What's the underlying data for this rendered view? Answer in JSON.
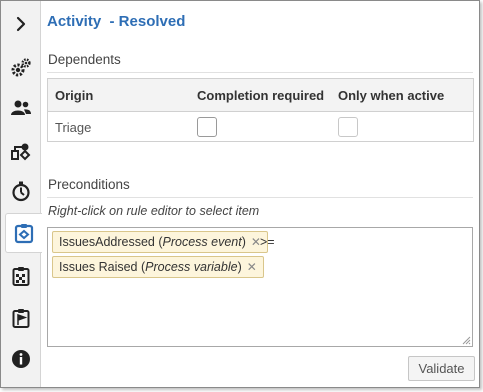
{
  "colors": {
    "accent": "#2e6eb5",
    "token_bg": "#fdf5dc",
    "token_border": "#d9c68b"
  },
  "sidebar": {
    "items": [
      {
        "icon": "chevron-right-icon"
      },
      {
        "icon": "gears-icon"
      },
      {
        "icon": "users-icon"
      },
      {
        "icon": "flowchart-icon"
      },
      {
        "icon": "stopwatch-icon"
      },
      {
        "icon": "activity-clipboard-icon",
        "active": true
      },
      {
        "icon": "checkered-clipboard-icon"
      },
      {
        "icon": "flag-clipboard-icon"
      },
      {
        "icon": "info-icon"
      }
    ]
  },
  "header": {
    "title": "Activity  - Resolved"
  },
  "dependents": {
    "label": "Dependents",
    "columns": [
      "Origin",
      "Completion required",
      "Only when active"
    ],
    "rows": [
      {
        "origin": "Triage",
        "completion_required": false,
        "only_when_active": false
      }
    ]
  },
  "preconditions": {
    "label": "Preconditions",
    "hint": "Right-click on rule editor to select item",
    "tokens": [
      {
        "name": "IssuesAddressed",
        "type": "Process event"
      },
      {
        "name": "Issues Raised",
        "type": "Process variable"
      }
    ],
    "operator": ">="
  },
  "validate_label": "Validate"
}
